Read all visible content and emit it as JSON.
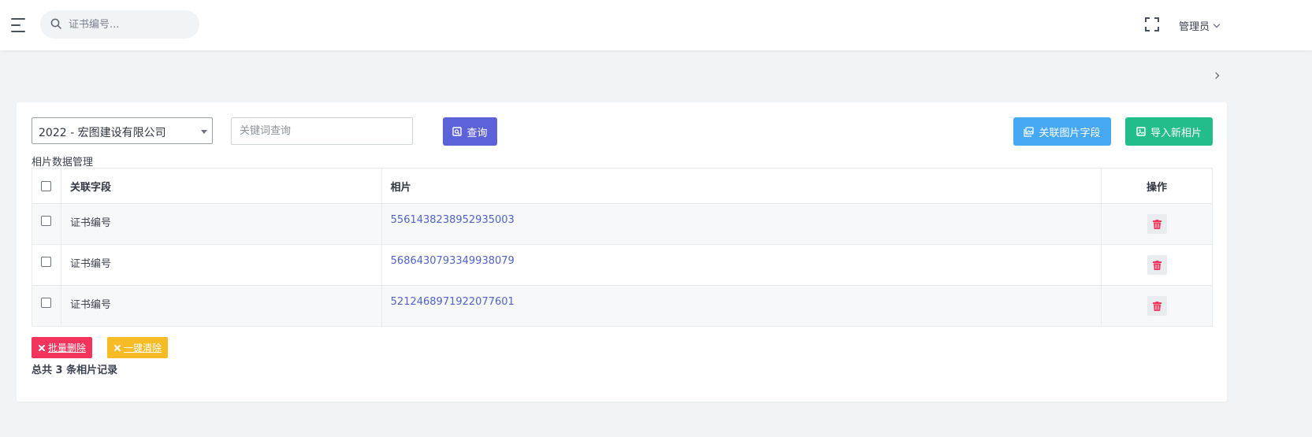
{
  "header": {
    "search_placeholder": "证书编号...",
    "user_label": "管理员"
  },
  "toolbar": {
    "year_company_value": "2022 - 宏图建设有限公司",
    "keyword_placeholder": "关键词查询",
    "query_label": "查询",
    "link_fields_label": "关联图片字段",
    "import_label": "导入新相片"
  },
  "table": {
    "caption": "相片数据管理",
    "columns": [
      "关联字段",
      "相片",
      "操作"
    ],
    "rows": [
      {
        "field": "证书编号",
        "photo": "5561438238952935003"
      },
      {
        "field": "证书编号",
        "photo": "5686430793349938079"
      },
      {
        "field": "证书编号",
        "photo": "5212468971922077601"
      }
    ]
  },
  "footer": {
    "batch_delete_label": "批量删除",
    "clear_all_label": "一键清除",
    "total_text": "总共 3 条相片记录"
  },
  "colors": {
    "primary": "#5c63d8",
    "info": "#47a9f4",
    "success": "#22bd8a",
    "danger": "#f3355e",
    "warning": "#f6bb25",
    "link": "#4f63c9"
  },
  "icons": {
    "menu": "menu-icon",
    "search": "search-icon",
    "fullscreen": "fullscreen-icon",
    "user_dropdown": "chevron-down-icon",
    "panel_toggle": "chevron-right-icon",
    "query": "search-file-icon",
    "link_fields": "images-icon",
    "import": "image-import-icon",
    "delete": "trash-icon",
    "batch_delete": "close-icon",
    "clear_all": "close-icon"
  }
}
